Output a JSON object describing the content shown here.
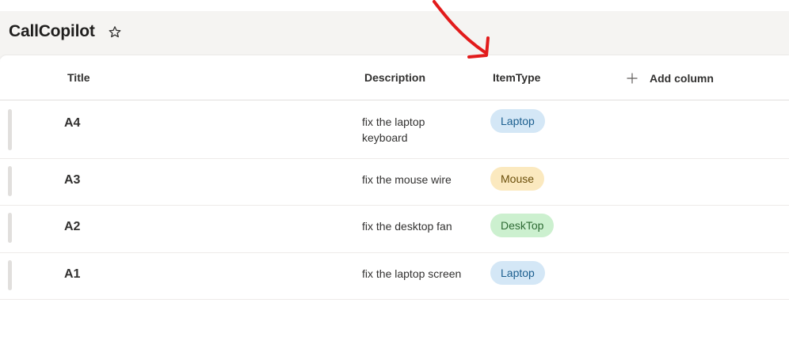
{
  "list": {
    "title": "CallCopilot"
  },
  "columns": {
    "title": "Title",
    "description": "Description",
    "item_type": "ItemType",
    "add_column": "Add column"
  },
  "rows": [
    {
      "title": "A4",
      "description": "fix the laptop keyboard",
      "item_type": "Laptop"
    },
    {
      "title": "A3",
      "description": "fix the mouse wire",
      "item_type": "Mouse"
    },
    {
      "title": "A2",
      "description": "fix the desktop fan",
      "item_type": "DeskTop"
    },
    {
      "title": "A1",
      "description": "fix the laptop screen",
      "item_type": "Laptop"
    }
  ],
  "pill_colors": {
    "Laptop": {
      "bg": "#d4e7f6",
      "fg": "#1b5e8e"
    },
    "Mouse": {
      "bg": "#fbe9bf",
      "fg": "#6b4f0a"
    },
    "DeskTop": {
      "bg": "#ccf0cf",
      "fg": "#2e6b34"
    }
  },
  "annotation_color": "#e21b1b",
  "icons": {
    "favorite": "star-icon",
    "add_column": "plus-icon",
    "annotation": "arrow-icon"
  }
}
